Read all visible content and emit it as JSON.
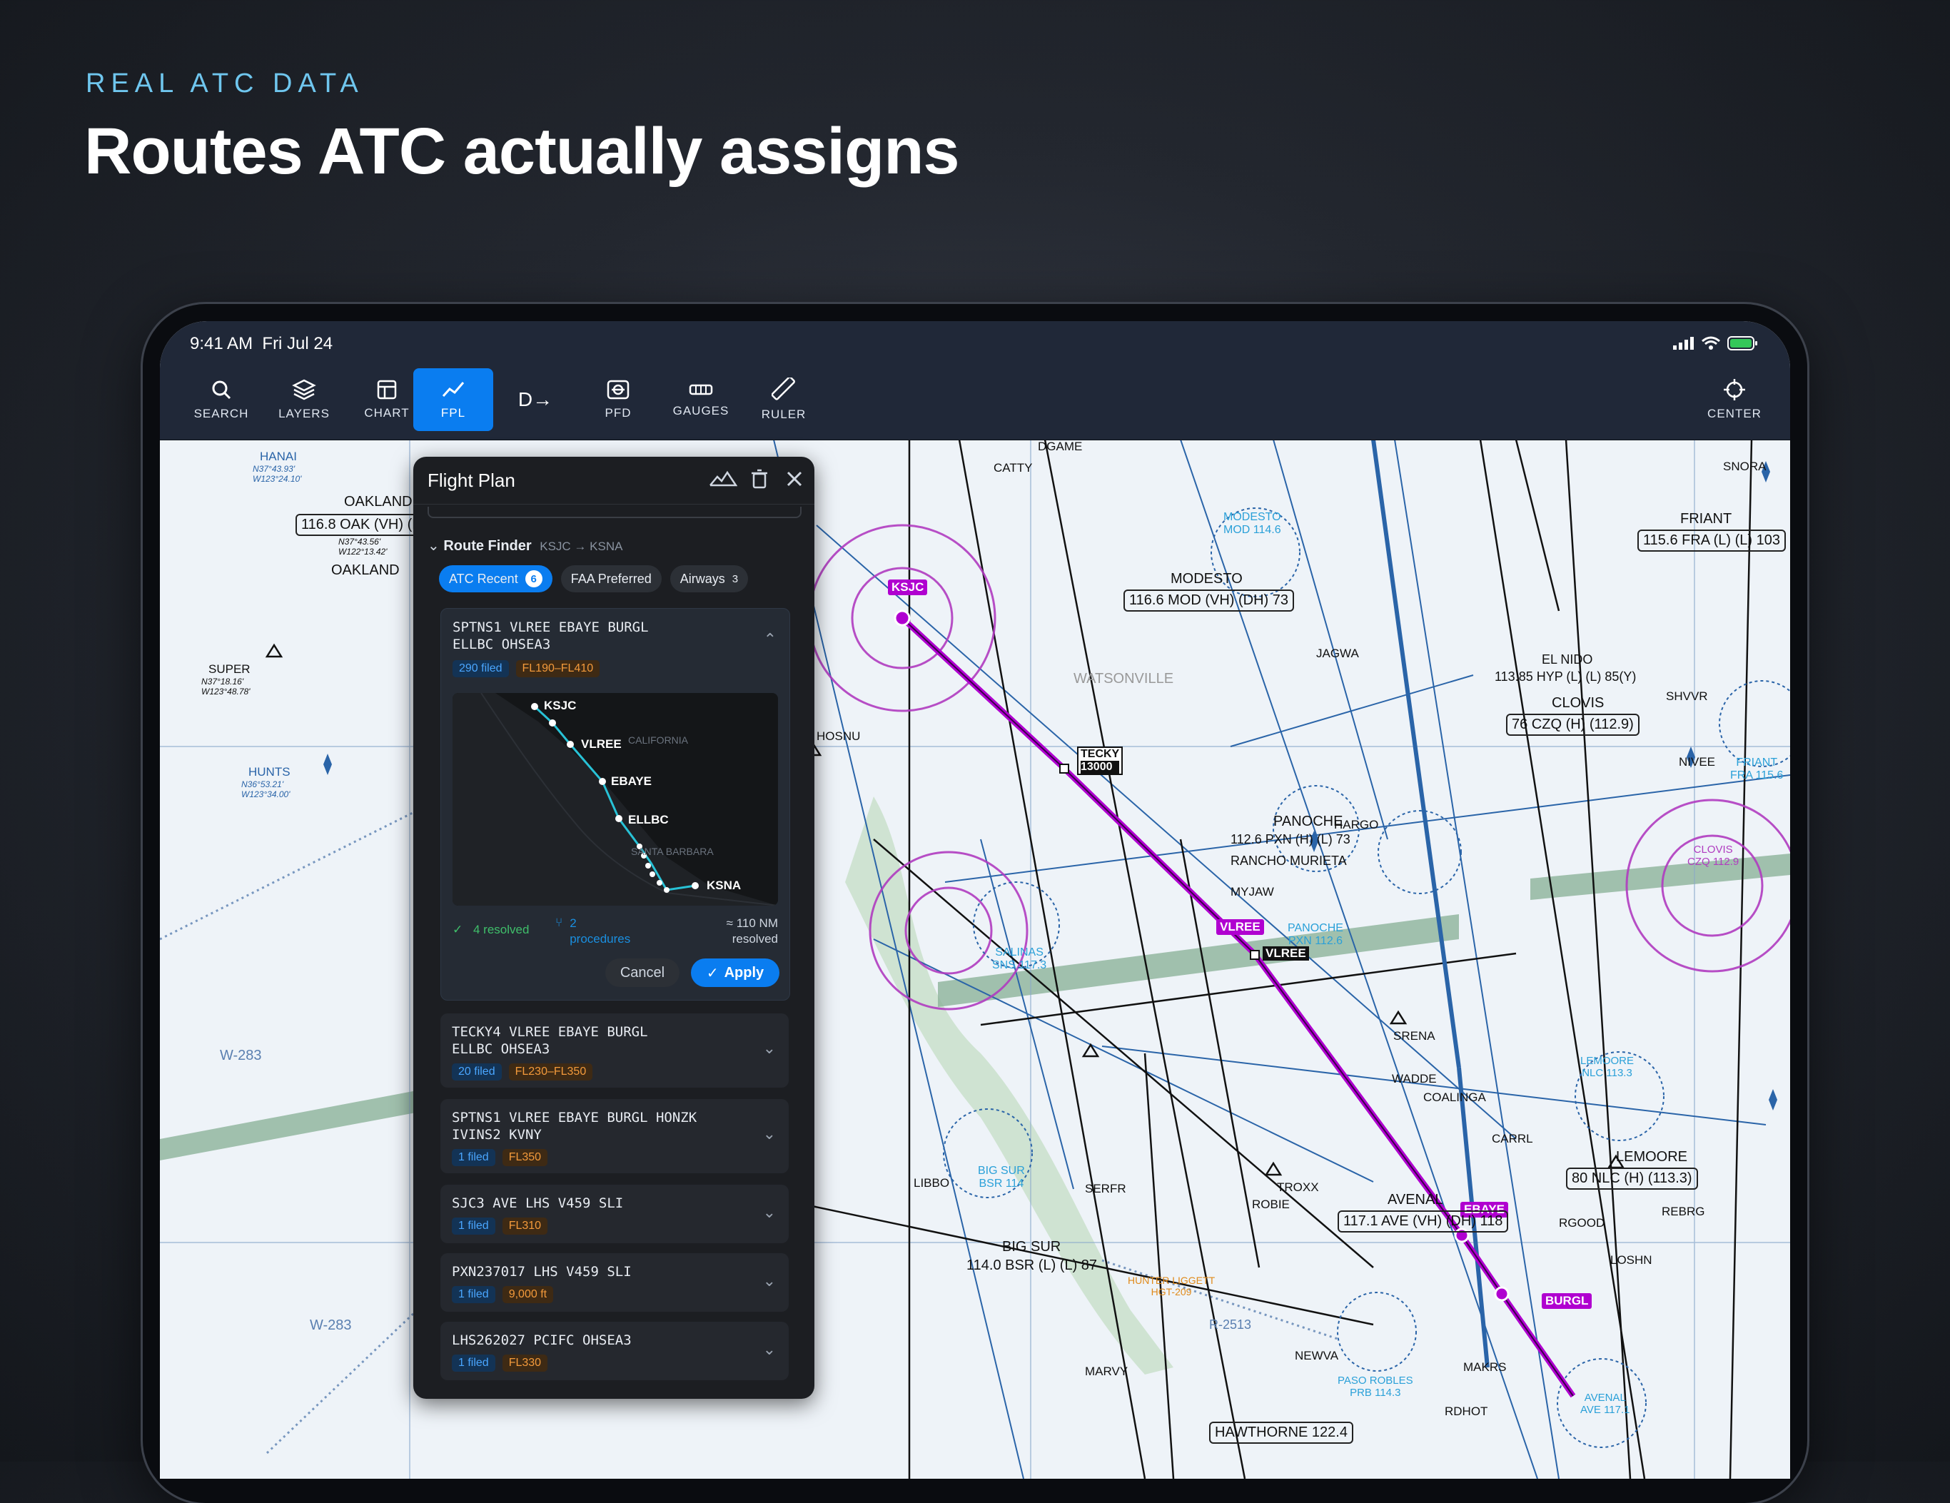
{
  "eyebrow": "REAL ATC DATA",
  "headline": "Routes ATC actually assigns",
  "status": {
    "time": "9:41 AM",
    "date": "Fri Jul 24"
  },
  "toolbar": {
    "search": "SEARCH",
    "layers": "LAYERS",
    "chart": "CHART",
    "fpl": "FPL",
    "direct": "D→",
    "pfd": "PFD",
    "gauges": "GAUGES",
    "ruler": "RULER",
    "center": "CENTER"
  },
  "panel": {
    "title": "Flight Plan",
    "finder_title": "Route Finder",
    "finder_route": "KSJC → KSNA",
    "tabs": [
      {
        "label": "ATC Recent",
        "count": "6"
      },
      {
        "label": "FAA Preferred",
        "count": ""
      },
      {
        "label": "Airways",
        "count": "3"
      }
    ],
    "routes": [
      {
        "text": "SPTNS1 VLREE EBAYE BURGL\nELLBC OHSEA3",
        "filed": "290 filed",
        "alt": "FL190–FL410"
      },
      {
        "text": "TECKY4 VLREE EBAYE BURGL\nELLBC OHSEA3",
        "filed": "20 filed",
        "alt": "FL230–FL350"
      },
      {
        "text": "SPTNS1 VLREE EBAYE BURGL HONZK\nIVINS2 KVNY",
        "filed": "1 filed",
        "alt": "FL350"
      },
      {
        "text": "SJC3 AVE LHS V459 SLI",
        "filed": "1 filed",
        "alt": "FL310"
      },
      {
        "text": "PXN237017 LHS V459 SLI",
        "filed": "1 filed",
        "alt": "9,000 ft"
      },
      {
        "text": "LHS262027 PCIFC OHSEA3",
        "filed": "1 filed",
        "alt": "FL330"
      }
    ],
    "mini_map": {
      "region": "CALIFORNIA",
      "region2": "SANTA BARBARA",
      "waypoints": [
        "KSJC",
        "VLREE",
        "EBAYE",
        "ELLBC",
        "KSNA"
      ]
    },
    "resolved": "4 resolved",
    "procedures": "2\nprocedures",
    "distance": "≈ 110 NM\nresolved",
    "cancel": "Cancel",
    "apply": "Apply"
  },
  "map_labels": {
    "hanai": "HANAI",
    "hanai_c": "N37°43.93'\nW123°24.10'",
    "oakland": "OAKLAND",
    "oakland_freq": "116.8 OAK (VH) (D",
    "oakland_c": "N37°43.56'\nW122°13.42'",
    "oakland2": "OAKLAND",
    "super": "SUPER",
    "super_c": "N37°18.16'\nW123°48.78'",
    "hunts": "HUNTS",
    "hunts_c": "N36°53.21'\nW123°34.00'",
    "w283a": "W-283",
    "w283b": "W-283",
    "ksjc": "KSJC",
    "tecky": "TECKY",
    "tecky_alt": "13000",
    "vlree": "VLREE",
    "vlree2": "VLREE",
    "ebaye": "EBAYE",
    "burgl": "BURGL",
    "modesto": "MODESTO",
    "modesto_freq": "116.6 MOD (VH) (DH) 73",
    "modesto_vor": "MODESTO\nMOD 114.6",
    "friant": "FRIANT",
    "friant_freq": "115.6 FRA (L) (L) 103",
    "friant_vor": "FRIANT\nFRA 115.6",
    "clovis": "CLOVIS",
    "clovis_freq": "76 CZQ (H) (112.9)",
    "clovis_vor": "CLOVIS\nCZQ 112.9",
    "el_nido": "EL NIDO",
    "el_nido_freq": "113.85 HYP (L) (L) 85(Y)",
    "panoche": "PANOCHE",
    "panoche_freq": "112.6 PXN (H) (L) 73",
    "rancho": "RANCHO MURIETA",
    "panoche_vor": "PANOCHE\nPXN 112.6",
    "salinas": "SALINAS\nSNS 117.3",
    "bigsur": "BIG SUR\nBSR 114",
    "bigsur_box": "BIG SUR",
    "bigsur_freq": "114.0 BSR (L) (L) 87",
    "lemoore": "LEMOORE",
    "lemoore_freq": "80 NLC (H) (113.3)",
    "lemoore_vor": "LEMOORE\nNLC 113.3",
    "avenal": "AVENAL",
    "avenal_freq": "117.1 AVE (VH) (DH) 118",
    "avenal_vor": "AVENAL\nAVE 117.1",
    "paso": "PASO ROBLES\nPRB 114.3",
    "hunter": "HUNTER LIGGETT\nHGT-209",
    "hawthorne": "HAWTHORNE 122.4",
    "r2513": "R-2513",
    "watsonville": "WATSONVILLE",
    "hosnu": "HOSNU",
    "hargo": "HARGO",
    "myjaw": "MYJAW",
    "jagwa": "JAGWA",
    "nivee": "NIVEE",
    "serfr": "SERFR",
    "troxx": "TROXX",
    "robie": "ROBIE",
    "srena": "SRENA",
    "wadde": "WADDE",
    "coalinga": "COALINGA",
    "rgood": "RGOOD",
    "losh": "LOSHN",
    "rebrg": "REBRG",
    "makrs": "MAKRS",
    "rdhot": "RDHOT",
    "newva": "NEWVA",
    "snora": "SNORA",
    "shvvr": "SHVVR",
    "carrl": "CARRL",
    "libbo": "LIBBO",
    "marvy": "MARVY",
    "catty": "CATTY",
    "dgame": "DGAME"
  },
  "colors": {
    "accent": "#0a7df0",
    "route": "#b000d0",
    "chart_blue": "#2a64a8",
    "airway_green": "#6a9f7a"
  }
}
